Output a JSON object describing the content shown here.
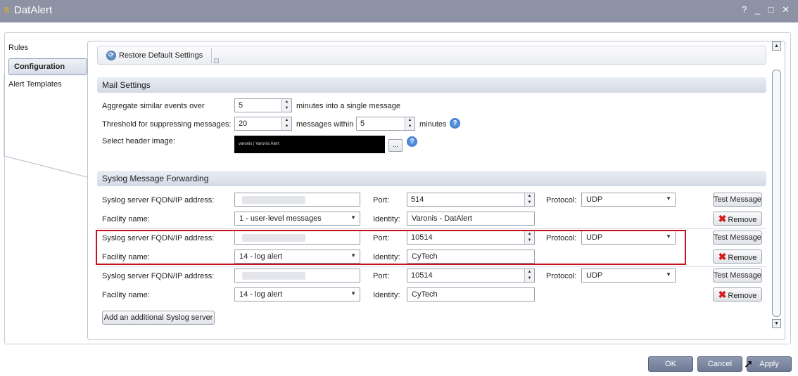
{
  "window": {
    "title": "DatAlert",
    "controls": "? _ □ ✕"
  },
  "nav": {
    "items": [
      {
        "label": "Rules"
      },
      {
        "label": "Configuration"
      },
      {
        "label": "Alert Templates"
      }
    ]
  },
  "toolbar": {
    "restore_label": "Restore Default Settings"
  },
  "mail": {
    "section_title": "Mail Settings",
    "aggregate_label": "Aggregate similar events over",
    "aggregate_value": "5",
    "aggregate_suffix": "minutes into a single message",
    "threshold_label": "Threshold for suppressing messages:",
    "threshold_value": "20",
    "threshold_mid": "messages within",
    "threshold_minutes": "5",
    "threshold_suffix": "minutes",
    "header_image_label": "Select header image:",
    "header_image_text": "varonis | Varonis Alert",
    "browse_label": "..."
  },
  "syslog": {
    "section_title": "Syslog Message Forwarding",
    "server_label": "Syslog server FQDN/IP address:",
    "facility_label": "Facility name:",
    "port_label": "Port:",
    "identity_label": "Identity:",
    "protocol_label": "Protocol:",
    "test_label": "Test Message",
    "remove_label": "Remove",
    "servers": [
      {
        "port": "514",
        "protocol": "UDP",
        "facility": "1 - user-level messages",
        "identity": "Varonis - DatAlert"
      },
      {
        "port": "10514",
        "protocol": "UDP",
        "facility": "14 - log alert",
        "identity": "CyTech"
      },
      {
        "port": "10514",
        "protocol": "UDP",
        "facility": "14 - log alert",
        "identity": "CyTech"
      }
    ],
    "add_label": "Add an additional Syslog server"
  },
  "footer": {
    "ok_label": "OK",
    "cancel_label": "Cancel",
    "apply_label": "Apply"
  },
  "colors": {
    "titlebar": "#8d93a5",
    "highlight_border": "#c8101c",
    "bottom_button": "#7a85a0"
  },
  "icons": {
    "restore": "refresh-icon",
    "help": "help-icon",
    "remove": "red-x-icon",
    "cursor": "mouse-pointer-icon"
  }
}
